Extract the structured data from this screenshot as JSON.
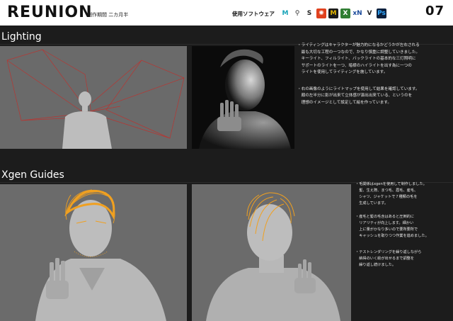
{
  "header": {
    "title": "REUNION",
    "period": "制作期間 二カ月半",
    "software_label": "使用ソフトウェア",
    "page_number": "07",
    "software_icons": [
      {
        "name": "maya-icon",
        "glyph": "M",
        "bg": "#ffffff",
        "fg": "#17a3b8"
      },
      {
        "name": "houdini-icon",
        "glyph": "⚲",
        "bg": "#ffffff",
        "fg": "#333333"
      },
      {
        "name": "substance-icon",
        "glyph": "S",
        "bg": "#ffffff",
        "fg": "#222222"
      },
      {
        "name": "arnold-icon",
        "glyph": "✺",
        "bg": "#e0411e",
        "fg": "#ffffff"
      },
      {
        "name": "mari-icon",
        "glyph": "M",
        "bg": "#1a1a1a",
        "fg": "#e6b800"
      },
      {
        "name": "xgen-icon",
        "glyph": "X",
        "bg": "#2f7d32",
        "fg": "#ffffff"
      },
      {
        "name": "xnormal-icon",
        "glyph": "xN",
        "bg": "#ffffff",
        "fg": "#1a4a9a"
      },
      {
        "name": "vray-icon",
        "glyph": "V",
        "bg": "#ffffff",
        "fg": "#222222"
      },
      {
        "name": "photoshop-icon",
        "glyph": "Ps",
        "bg": "#0a1f3c",
        "fg": "#31a8ff"
      }
    ]
  },
  "lighting": {
    "title": "Lighting",
    "text_1": "・ライティングはキャラクターが魅力的になるかどうかが左右される\n　最も大切な工程の一つなので、かなり慎重に調整していきました。\n　キーライト、フィルライト、バックライトの基本的な三灯照明に\n　サポートのライトを一つ、暗様のハイライトを出す為に一つの\n　ライトを使用してライティングを施しています。",
    "text_2": "・右の画像のようにライトマップを使用して結果を確認しています。\n　顔の左半分に影が出来て立体感が演出出来ている、というのを\n　理想のイメージとして設定して絵を作っています。"
  },
  "xgen": {
    "title": "Xgen Guides",
    "text_1": "・毛関係はxgenを使用して制作しました。\n　髪、生え際、まつ毛、眉毛、産毛、\n　シャツ、ジャケットで７種類の毛を\n　生成しています。",
    "text_2": "・産毛と髪の毛含はあると圧倒的に\n　リアリティが向上します。細かい\n　上に量がかなり多いので要所要所で\n　キャッシュを取りつつ作業を進めました。",
    "text_3": "・テストレンダリングを繰り返しながら\n　納得のいく絵が出せるまで調整を\n　繰り返し続けました。"
  },
  "colors": {
    "guide_orange": "#f0a020",
    "light_red": "#c0302c",
    "viewport_gray": "#6b6b6b"
  }
}
